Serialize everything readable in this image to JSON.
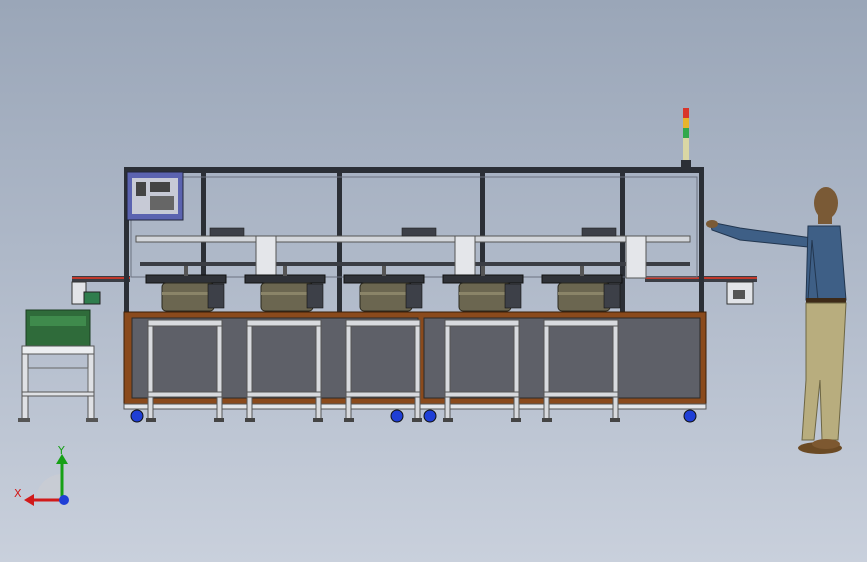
{
  "triad": {
    "x_label": "X",
    "y_label": "Y",
    "x_color": "#d11a1a",
    "y_color": "#16a016",
    "z_color": "#1f3fd6"
  },
  "scene": {
    "stations": 5,
    "frame_color": "#2b2f36",
    "base_color": "#8a4a1c",
    "panel_color": "#5e6068",
    "stand_color": "#d8dade",
    "bowl_color": "#6b6650",
    "crate_color": "#2f6b3a",
    "person_shirt_color": "#3e5f86",
    "person_pants_color": "#b8ad7e",
    "signal_tower_colors": [
      "#d9352b",
      "#e7b42b",
      "#32a84b"
    ]
  }
}
